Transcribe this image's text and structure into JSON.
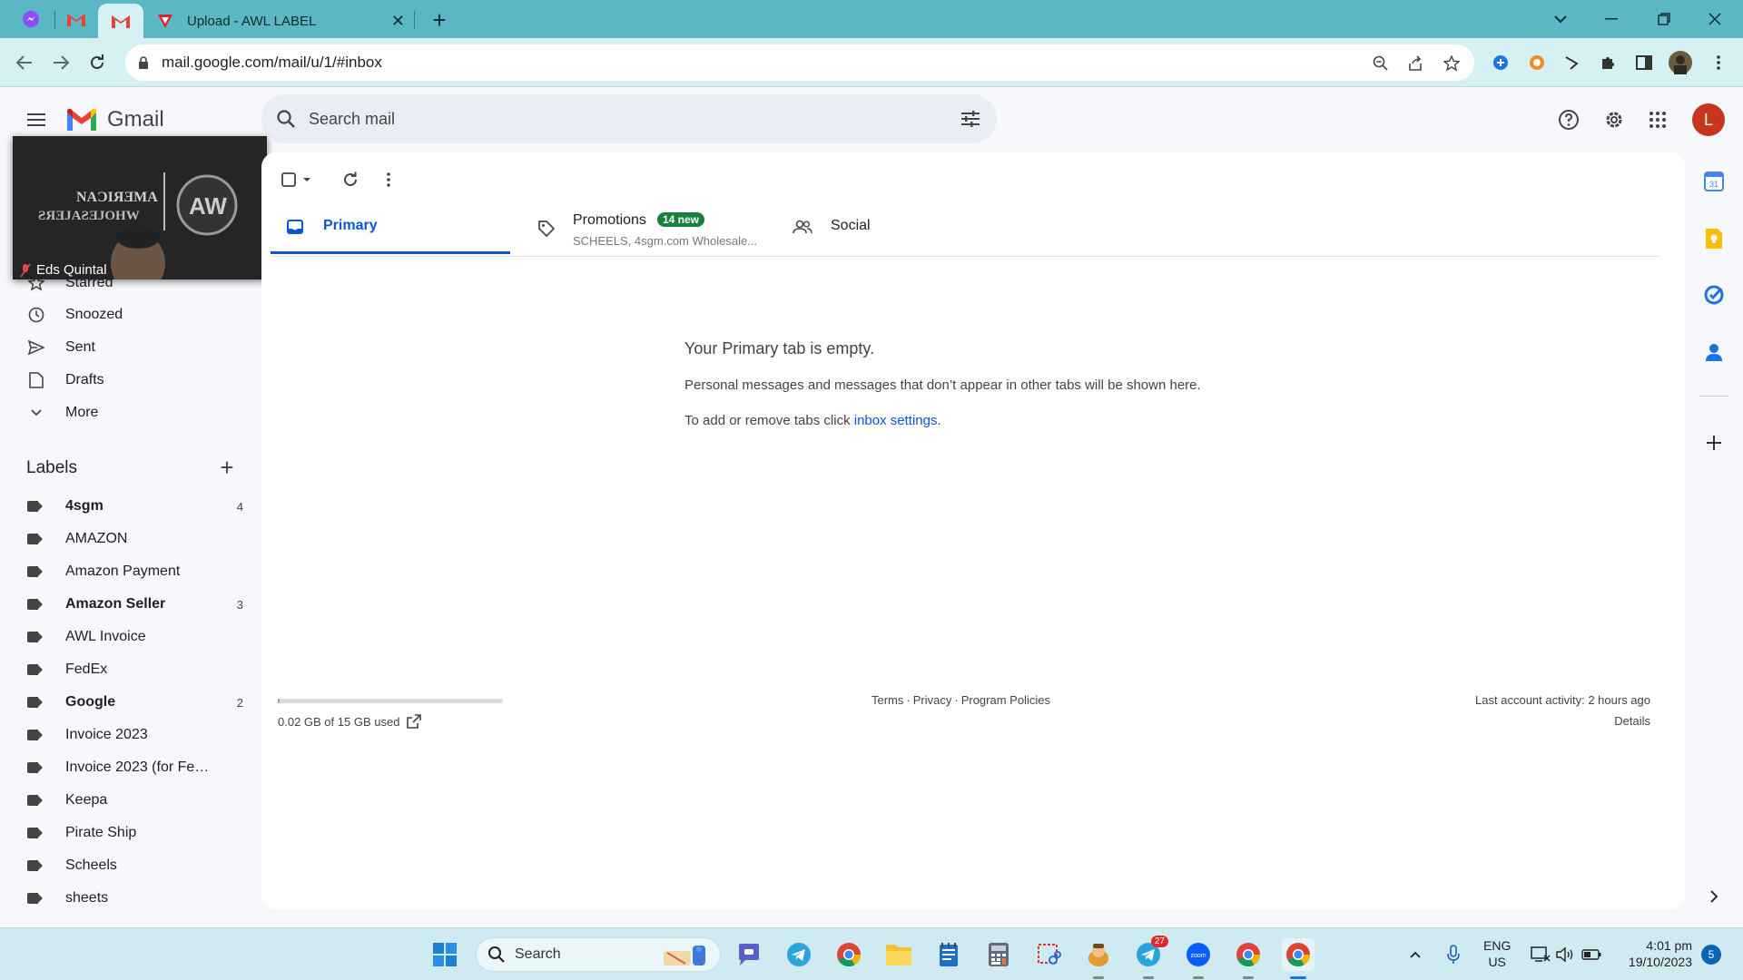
{
  "browser": {
    "tabs": [
      {
        "title": "Upload - AWL LABEL",
        "close": "✕"
      }
    ],
    "new_tab": "+",
    "url": "mail.google.com/mail/u/1/#inbox"
  },
  "gmail": {
    "brand": "Gmail",
    "search_placeholder": "Search mail",
    "avatar_letter": "L"
  },
  "sidebar": {
    "items": [
      {
        "label": "Starred",
        "icon": "star-icon"
      },
      {
        "label": "Snoozed",
        "icon": "clock-icon"
      },
      {
        "label": "Sent",
        "icon": "send-icon"
      },
      {
        "label": "Drafts",
        "icon": "draft-icon"
      },
      {
        "label": "More",
        "icon": "chevron-down-icon"
      }
    ],
    "labels_title": "Labels",
    "labels": [
      {
        "name": "4sgm",
        "count": "4",
        "bold": true
      },
      {
        "name": "AMAZON",
        "count": "",
        "bold": false
      },
      {
        "name": "Amazon Payment",
        "count": "",
        "bold": false
      },
      {
        "name": "Amazon Seller",
        "count": "3",
        "bold": true
      },
      {
        "name": "AWL Invoice",
        "count": "",
        "bold": false
      },
      {
        "name": "FedEx",
        "count": "",
        "bold": false
      },
      {
        "name": "Google",
        "count": "2",
        "bold": true
      },
      {
        "name": "Invoice 2023",
        "count": "",
        "bold": false
      },
      {
        "name": "Invoice 2023 (for FedEx ...",
        "count": "",
        "bold": false
      },
      {
        "name": "Keepa",
        "count": "",
        "bold": false
      },
      {
        "name": "Pirate Ship",
        "count": "",
        "bold": false
      },
      {
        "name": "Scheels",
        "count": "",
        "bold": false
      },
      {
        "name": "sheets",
        "count": "",
        "bold": false
      }
    ]
  },
  "video": {
    "participant": "Eds Quintal"
  },
  "inbox": {
    "tabs": {
      "primary": "Primary",
      "promotions": "Promotions",
      "promotions_badge": "14 new",
      "promotions_sub": "SCHEELS, 4sgm.com Wholesale...",
      "social": "Social"
    },
    "empty_title": "Your Primary tab is empty.",
    "empty_desc": "Personal messages and messages that don’t appear in other tabs will be shown here.",
    "empty_settings_prefix": "To add or remove tabs click ",
    "empty_settings_link": "inbox settings",
    "empty_settings_suffix": "."
  },
  "footer": {
    "storage": "0.02 GB of 15 GB used",
    "storage_fraction": 0.0013,
    "terms": "Terms",
    "privacy": "Privacy",
    "policies": "Program Policies",
    "sep": "·",
    "activity": "Last account activity: 2 hours ago",
    "details": "Details"
  },
  "taskbar": {
    "search": "Search",
    "telegram_badge": "27",
    "lang_line1": "ENG",
    "lang_line2": "US",
    "time": "4:01 pm",
    "date": "19/10/2023",
    "notifications": "5"
  },
  "colors": {
    "tabbar": "#5bb7c4",
    "toolbar": "#d6f1f4",
    "accent": "#0b57d0",
    "badge_green": "#188038",
    "avatar": "#c6361c"
  }
}
